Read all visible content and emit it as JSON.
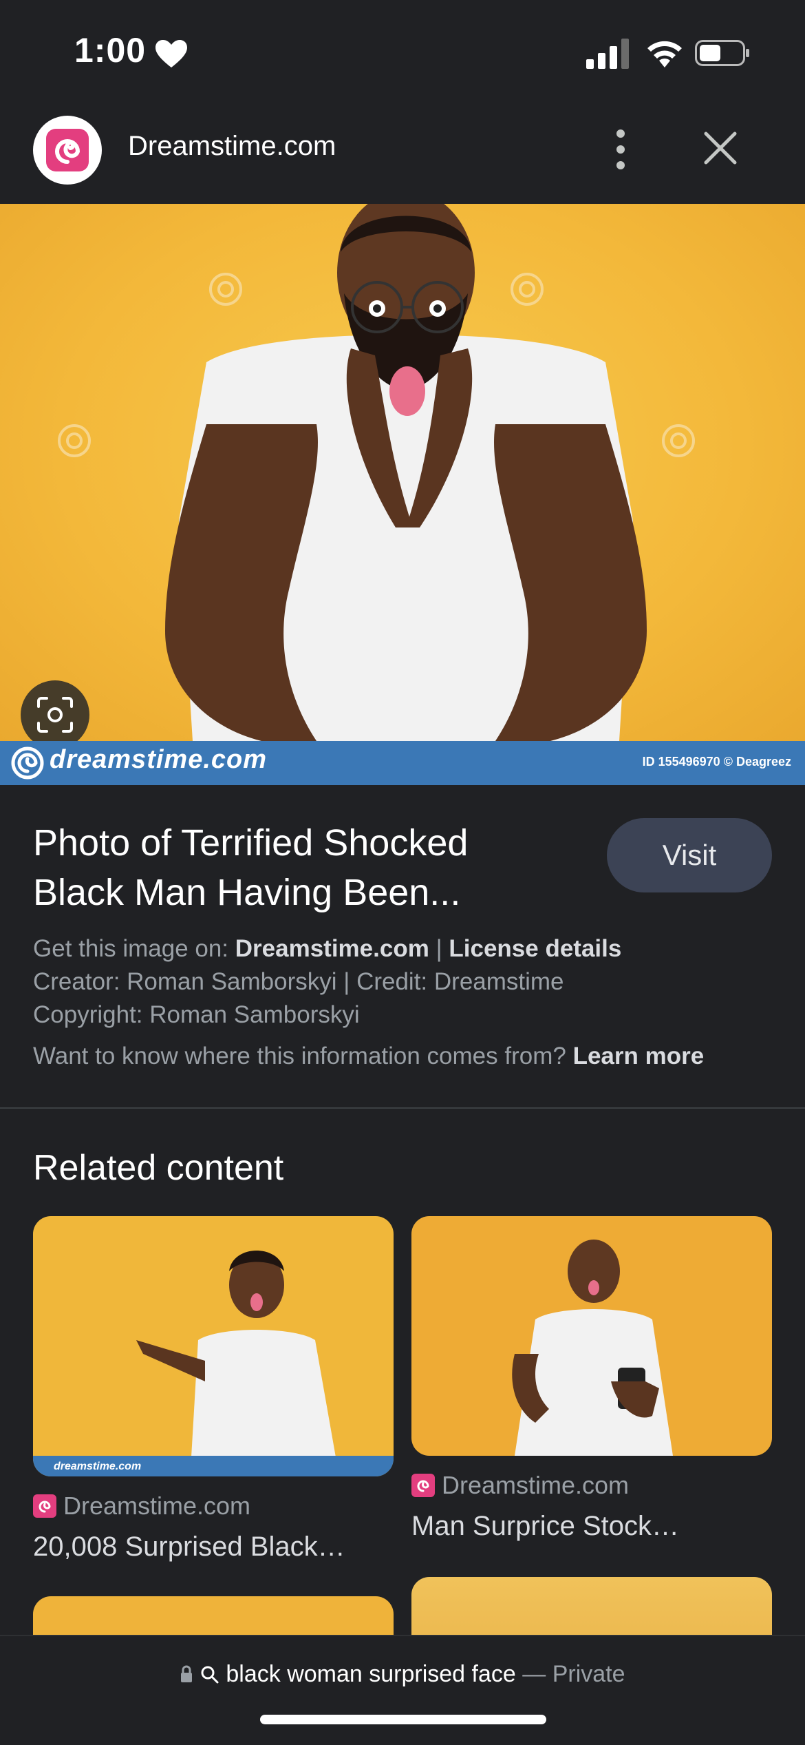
{
  "status": {
    "time": "1:00"
  },
  "header": {
    "site_name": "Dreamstime.com"
  },
  "hero": {
    "watermark_brand": "dreamstime.com",
    "watermark_id": "ID 155496970 © Deagreez"
  },
  "details": {
    "title_line1": "Photo of Terrified Shocked",
    "title_line2": "Black Man Having Been...",
    "visit_label": "Visit",
    "get_image_prefix": "Get this image on: ",
    "get_image_site": "Dreamstime.com",
    "separator": " | ",
    "license_link": "License details",
    "creator_line": "Creator: Roman Samborskyi | Credit: Dreamstime",
    "copyright_line": "Copyright: Roman Samborskyi",
    "info_question": "Want to know where this information comes from? ",
    "learn_more": "Learn more"
  },
  "related": {
    "heading": "Related content",
    "cards": [
      {
        "source": "Dreamstime.com",
        "title": "20,008 Surprised Black…",
        "watermark": "dreamstime.com"
      },
      {
        "source": "Dreamstime.com",
        "title": "Man Surprice Stock…"
      }
    ]
  },
  "bottom": {
    "query": "black woman surprised face",
    "dash": " — ",
    "private_label": "Private"
  }
}
